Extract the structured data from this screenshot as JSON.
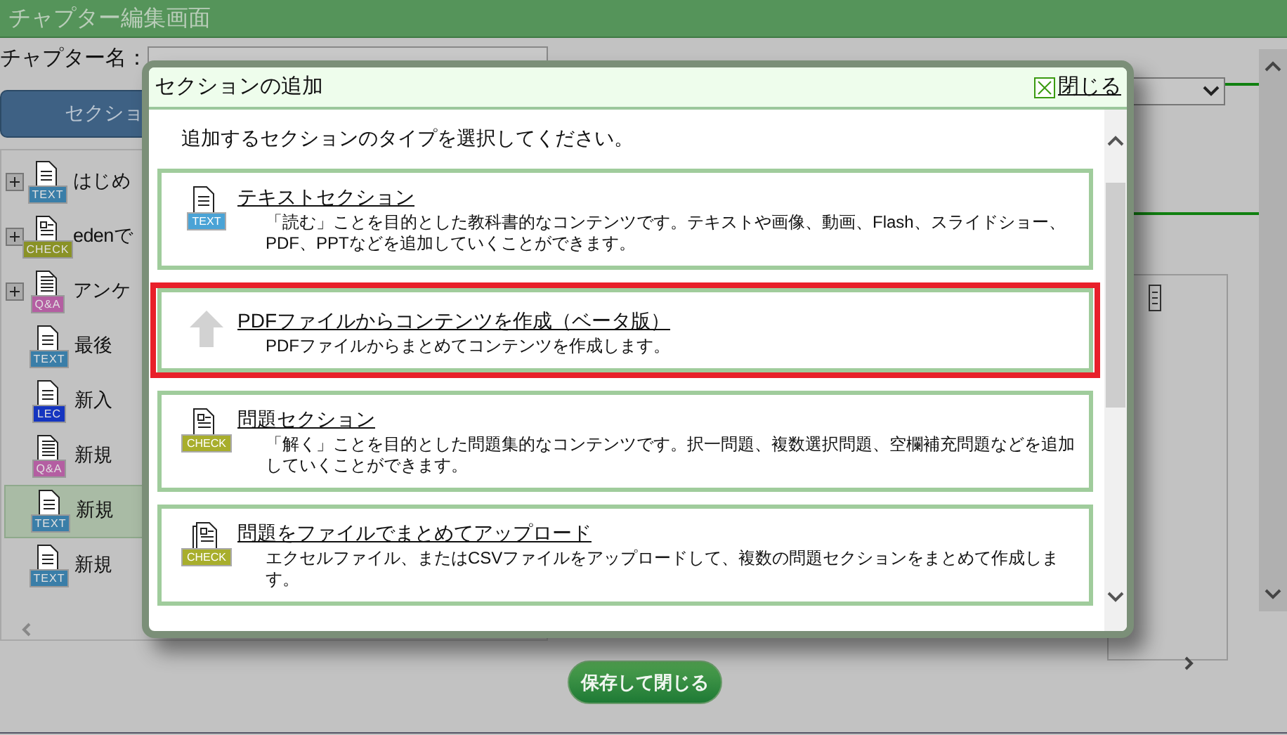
{
  "window": {
    "title": "チャプター編集画面"
  },
  "chapter": {
    "label": "チャプター名："
  },
  "section_button": {
    "label": "セクショ"
  },
  "tree": {
    "items": [
      {
        "label": "はじめ",
        "badge": "TEXT",
        "kind": "text",
        "expanded": false,
        "selected": false
      },
      {
        "label": "edenで",
        "badge": "CHECK",
        "kind": "check",
        "expanded": false,
        "selected": false
      },
      {
        "label": "アンケ",
        "badge": "Q&A",
        "kind": "qa",
        "expanded": false,
        "selected": false
      },
      {
        "label": "最後",
        "badge": "TEXT",
        "kind": "text",
        "selected": false
      },
      {
        "label": "新入",
        "badge": "LEC",
        "kind": "lec",
        "selected": false
      },
      {
        "label": "新規",
        "badge": "Q&A",
        "kind": "qa",
        "selected": false
      },
      {
        "label": "新規",
        "badge": "TEXT",
        "kind": "text",
        "selected": true
      },
      {
        "label": "新規",
        "badge": "TEXT",
        "kind": "text",
        "selected": false
      }
    ]
  },
  "modal": {
    "title": "セクションの追加",
    "close": "閉じる",
    "instruction": "追加するセクションのタイプを選択してください。",
    "options": [
      {
        "kind": "text",
        "badge": "TEXT",
        "title": "テキストセクション",
        "description": "「読む」ことを目的とした教科書的なコンテンツです。テキストや画像、動画、Flash、スライドショー、PDF、PPTなどを追加していくことができます。",
        "highlighted": false
      },
      {
        "kind": "upload",
        "title": "PDFファイルからコンテンツを作成（ベータ版）",
        "description": "PDFファイルからまとめてコンテンツを作成します。",
        "highlighted": true
      },
      {
        "kind": "check",
        "badge": "CHECK",
        "title": "問題セクション",
        "description": "「解く」ことを目的とした問題集的なコンテンツです。択一問題、複数選択問題、空欄補充問題などを追加していくことができます。",
        "highlighted": false
      },
      {
        "kind": "multicheck",
        "badge": "CHECK",
        "title": "問題をファイルでまとめてアップロード",
        "description": "エクセルファイル、またはCSVファイルをアップロードして、複数の問題セクションをまとめて作成します。",
        "highlighted": false
      }
    ]
  },
  "save_button": {
    "label": "保存して閉じる"
  }
}
